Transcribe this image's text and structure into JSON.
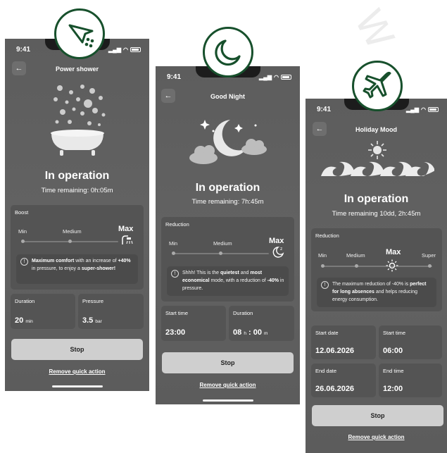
{
  "screens": [
    {
      "status_time": "9:41",
      "title": "Power shower",
      "status": "In operation",
      "remaining": "Time remaining: 0h:05m",
      "section_label": "Boost",
      "levels": [
        "Min",
        "Medium",
        "Max"
      ],
      "tip_parts": [
        "Maximum comfort",
        " with an increase of ",
        "+40%",
        " in pressure, to enjoy a ",
        "super-shower!"
      ],
      "fields": [
        {
          "label": "Duration",
          "value": "20",
          "unit": "min"
        },
        {
          "label": "Pressure",
          "value": "3.5",
          "unit": "bar"
        }
      ],
      "stop_label": "Stop",
      "remove_label": "Remove quick action"
    },
    {
      "status_time": "9:41",
      "title": "Good Night",
      "status": "In operation",
      "remaining": "Time remaining: 7h:45m",
      "section_label": "Reduction",
      "levels": [
        "Min",
        "Medium",
        "Max"
      ],
      "tip_parts": [
        "Shhh! This is the ",
        "quietest",
        " and ",
        "most economical",
        " mode, with a reduction of ",
        "-40%",
        " in pressure."
      ],
      "fields": [
        {
          "label": "Start time",
          "value": "23:00"
        },
        {
          "label": "Duration",
          "value": "08",
          "unit_h": "h",
          "value2": "00",
          "unit_m": "m"
        }
      ],
      "stop_label": "Stop",
      "remove_label": "Remove quick action"
    },
    {
      "status_time": "9:41",
      "title": "Holiday Mood",
      "status": "In operation",
      "remaining": "Time remaining 10dd, 2h:45m",
      "section_label": "Reduction",
      "levels": [
        "Min",
        "Medium",
        "Max",
        "Super"
      ],
      "tip_parts": [
        "The maximum reduction of -40% is ",
        "perfect for long absences",
        " and helps reducing energy consumption."
      ],
      "fields": [
        {
          "label": "Start date",
          "value": "12.06.2026"
        },
        {
          "label": "Start time",
          "value": "06:00"
        },
        {
          "label": "End date",
          "value": "26.06.2026"
        },
        {
          "label": "End time",
          "value": "12:00"
        }
      ],
      "stop_label": "Stop",
      "remove_label": "Remove quick action"
    }
  ],
  "badges": [
    "shower-head-icon",
    "moon-icon",
    "airplane-icon"
  ],
  "colors": {
    "badge_ring": "#17502c",
    "phone_bg": "#5f5f5f",
    "panel_bg": "#545454",
    "button_bg": "#cfcfcf"
  }
}
